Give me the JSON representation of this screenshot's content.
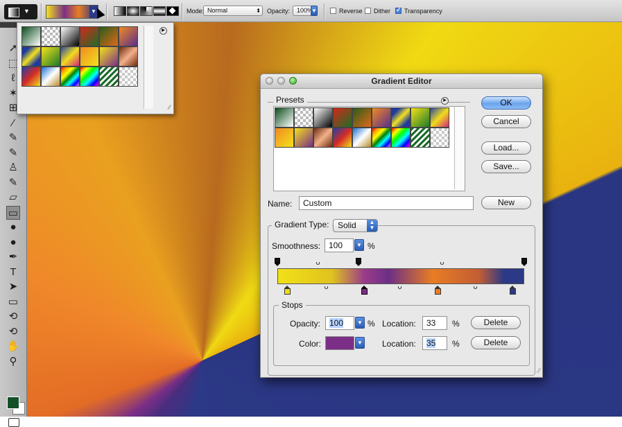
{
  "options_bar": {
    "mode_label": "Mode:",
    "mode_value": "Normal",
    "opacity_label": "Opacity:",
    "opacity_value": "100%",
    "reverse_label": "Reverse",
    "reverse_checked": false,
    "dither_label": "Dither",
    "dither_checked": false,
    "transparency_label": "Transparency",
    "transparency_checked": true,
    "gradient_types": [
      "linear",
      "radial",
      "angle",
      "reflected",
      "diamond"
    ]
  },
  "toolbox": {
    "tools": [
      "move-tool",
      "marquee-tool",
      "lasso-tool",
      "magic-wand-tool",
      "crop-tool",
      "eyedropper-tool",
      "healing-brush-tool",
      "brush-tool",
      "clone-stamp-tool",
      "history-brush-tool",
      "eraser-tool",
      "gradient-tool",
      "blur-tool",
      "dodge-tool",
      "pen-tool",
      "type-tool",
      "path-selection-tool",
      "shape-tool",
      "3d-rotate-tool",
      "3d-orbit-tool",
      "hand-tool",
      "zoom-tool"
    ],
    "active_tool": "gradient-tool",
    "foreground_color": "#144f2a",
    "background_color": "#ffffff"
  },
  "presets_popup": {
    "swatches": [
      "black-white-green",
      "transparent-checker",
      "black-white",
      "red-green",
      "orange-green",
      "violet-orange",
      "red-yellow-blue",
      "green-yellow",
      "blue-yellow-pink",
      "orange-yellow",
      "yellow-violet",
      "copper",
      "blue-red-yellow",
      "chrome",
      "rainbow",
      "spectrum-transparent",
      "green-stripes",
      "transparent"
    ]
  },
  "dialog": {
    "title": "Gradient Editor",
    "presets_label": "Presets",
    "buttons": {
      "ok": "OK",
      "cancel": "Cancel",
      "load": "Load...",
      "save": "Save...",
      "new": "New"
    },
    "name_label": "Name:",
    "name_value": "Custom",
    "gradient_type_label": "Gradient Type:",
    "gradient_type_value": "Solid",
    "smoothness_label": "Smoothness:",
    "smoothness_value": "100",
    "smoothness_unit": "%",
    "stops_label": "Stops",
    "opacity_label": "Opacity:",
    "opacity_value": "100",
    "opacity_unit": "%",
    "opacity_location_label": "Location:",
    "opacity_location_value": "33",
    "opacity_location_unit": "%",
    "color_label": "Color:",
    "color_value": "#7b2f86",
    "color_location_label": "Location:",
    "color_location_value": "35",
    "color_location_unit": "%",
    "delete_label": "Delete",
    "color_stops": [
      {
        "color": "#f0dd16",
        "location": 4
      },
      {
        "color": "#7b2f86",
        "location": 35
      },
      {
        "color": "#e87d23",
        "location": 63
      },
      {
        "color": "#2c3986",
        "location": 95
      }
    ],
    "opacity_stops": [
      0,
      33,
      100
    ]
  }
}
